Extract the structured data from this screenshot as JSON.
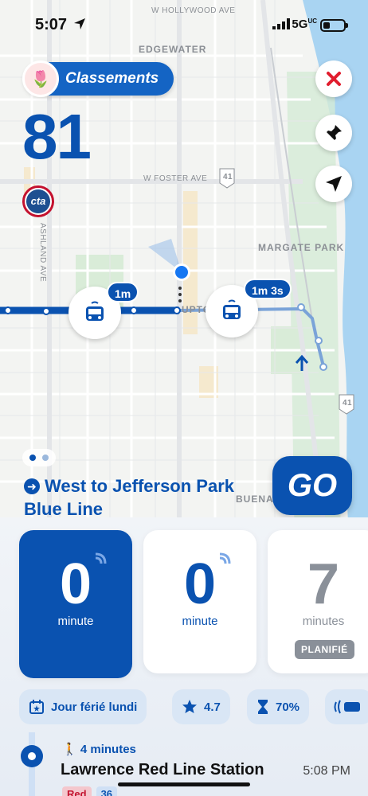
{
  "status_bar": {
    "time": "5:07",
    "network": "5G",
    "network_suffix": "UC"
  },
  "map": {
    "labels": {
      "edgewater": "EDGEWATER",
      "hollywood": "W HOLLYWOOD AVE",
      "foster": "W FOSTER AVE",
      "route_41_top": "41",
      "route_41_bottom": "41",
      "margate": "MARGATE PARK",
      "ashland": "ASHLAND AVE",
      "uptown": "UPTO",
      "buena": "BUENA"
    },
    "buses": [
      {
        "eta": "1m"
      },
      {
        "eta": "1m 3s"
      }
    ]
  },
  "header": {
    "rank_label": "Classements",
    "rank_avatar": "🌷",
    "route_number": "81",
    "agency_logo": "cta"
  },
  "controls": {
    "close_icon": "close-icon",
    "pin_icon": "pin-icon",
    "locate_icon": "location-arrow-icon"
  },
  "direction": {
    "text": "West to Jefferson Park Blue Line",
    "go_label": "GO"
  },
  "arrivals": [
    {
      "value": "0",
      "unit": "minute",
      "realtime": true,
      "active": true
    },
    {
      "value": "0",
      "unit": "minute",
      "realtime": true,
      "active": false
    },
    {
      "value": "7",
      "unit": "minutes",
      "realtime": false,
      "active": false,
      "badge": "PLANIFIÉ"
    }
  ],
  "chips": {
    "holiday": "Jour férié lundi",
    "rating": "4.7",
    "crowding": "70%"
  },
  "next_stop": {
    "walk": "4 minutes",
    "name": "Lawrence Red Line Station",
    "time": "5:08 PM",
    "line_red": "Red",
    "line_bus": "36"
  },
  "colors": {
    "primary": "#0a52b0",
    "red": "#c4122f",
    "close": "#e11d2e"
  }
}
